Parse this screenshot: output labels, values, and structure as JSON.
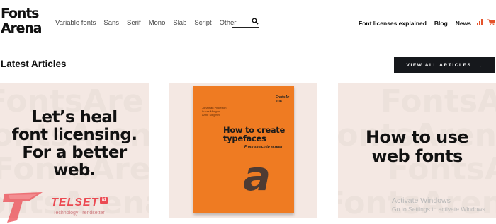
{
  "brand": {
    "logo_line1": "Fonts",
    "logo_line2": "Arena"
  },
  "nav": {
    "items": [
      "Variable fonts",
      "Sans",
      "Serif",
      "Mono",
      "Slab",
      "Script",
      "Other"
    ],
    "right_items": [
      "Font licenses explained",
      "Blog",
      "News"
    ]
  },
  "search": {
    "value": ""
  },
  "section": {
    "title": "Latest Articles",
    "view_all_label": "VIEW ALL ARTICLES",
    "view_all_arrow": "→"
  },
  "cards": [
    {
      "lines": [
        "Let’s heal",
        "font licensing.",
        "For a better",
        "web."
      ],
      "watermark": "FontsArena"
    },
    {
      "book": {
        "mark": "FontsArena",
        "authors": [
          "Jonathan Pinkerton",
          "Lucas Morgan",
          "Anne Siegfried"
        ],
        "title": "How to create typefaces",
        "subtitle": "From sketch to screen",
        "glyph": "a"
      }
    },
    {
      "lines": [
        "How to use",
        "web fonts"
      ],
      "watermark": "FontsArena"
    }
  ],
  "overlay": {
    "activate_title": "Activate Windows",
    "activate_sub": "Go to Settings to activate Windows.",
    "telset_word": "TELSET",
    "telset_badge": "id",
    "telset_tagline": "Technology Trendsetter"
  },
  "colors": {
    "accent_dark": "#16181c",
    "card_bg": "#f4e8e3",
    "book_orange": "#ef7b22",
    "telset_red": "#eb4a52"
  }
}
